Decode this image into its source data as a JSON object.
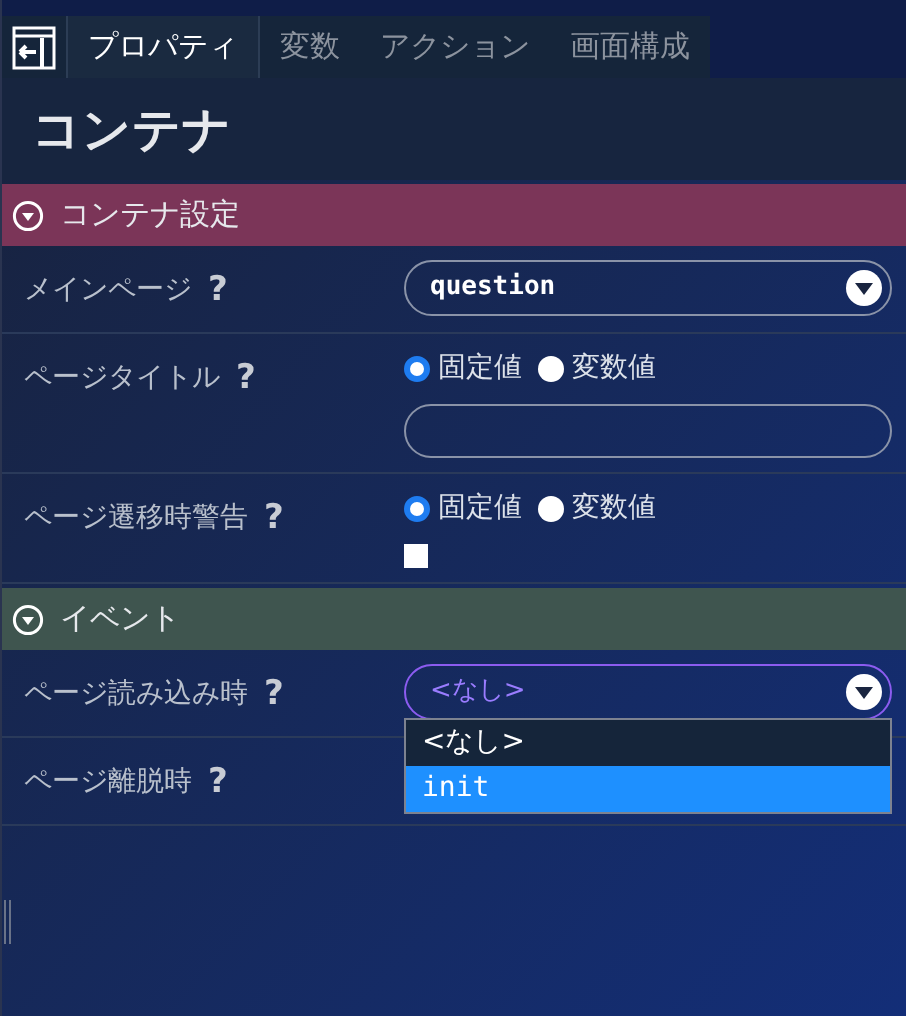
{
  "tabs": [
    {
      "label": "プロパティ",
      "selected": true
    },
    {
      "label": "変数",
      "selected": false
    },
    {
      "label": "アクション",
      "selected": false
    },
    {
      "label": "画面構成",
      "selected": false
    }
  ],
  "title": "コンテナ",
  "sections": [
    {
      "label": "コンテナ設定",
      "color": "#7b3558",
      "expanded": true,
      "rows": [
        {
          "kind": "select",
          "label": "メインページ",
          "help": "?",
          "value": "question",
          "focused": false
        },
        {
          "kind": "radio_text",
          "label": "ページタイトル",
          "help": "?",
          "options": [
            {
              "label": "固定値",
              "selected": true
            },
            {
              "label": "変数値",
              "selected": false
            }
          ]
        },
        {
          "kind": "radio_check",
          "label": "ページ遷移時警告",
          "help": "?",
          "options": [
            {
              "label": "固定値",
              "selected": true
            },
            {
              "label": "変数値",
              "selected": false
            }
          ],
          "checked": false
        }
      ]
    },
    {
      "label": "イベント",
      "color": "#3f554f",
      "expanded": true,
      "rows": [
        {
          "kind": "select",
          "label": "ページ読み込み時",
          "help": "?",
          "value": "<なし>",
          "focused": true,
          "menu": [
            {
              "label": "<なし>",
              "highlighted": false
            },
            {
              "label": "init",
              "highlighted": true
            }
          ]
        },
        {
          "kind": "plain",
          "label": "ページ離脱時",
          "help": "?"
        }
      ]
    }
  ]
}
